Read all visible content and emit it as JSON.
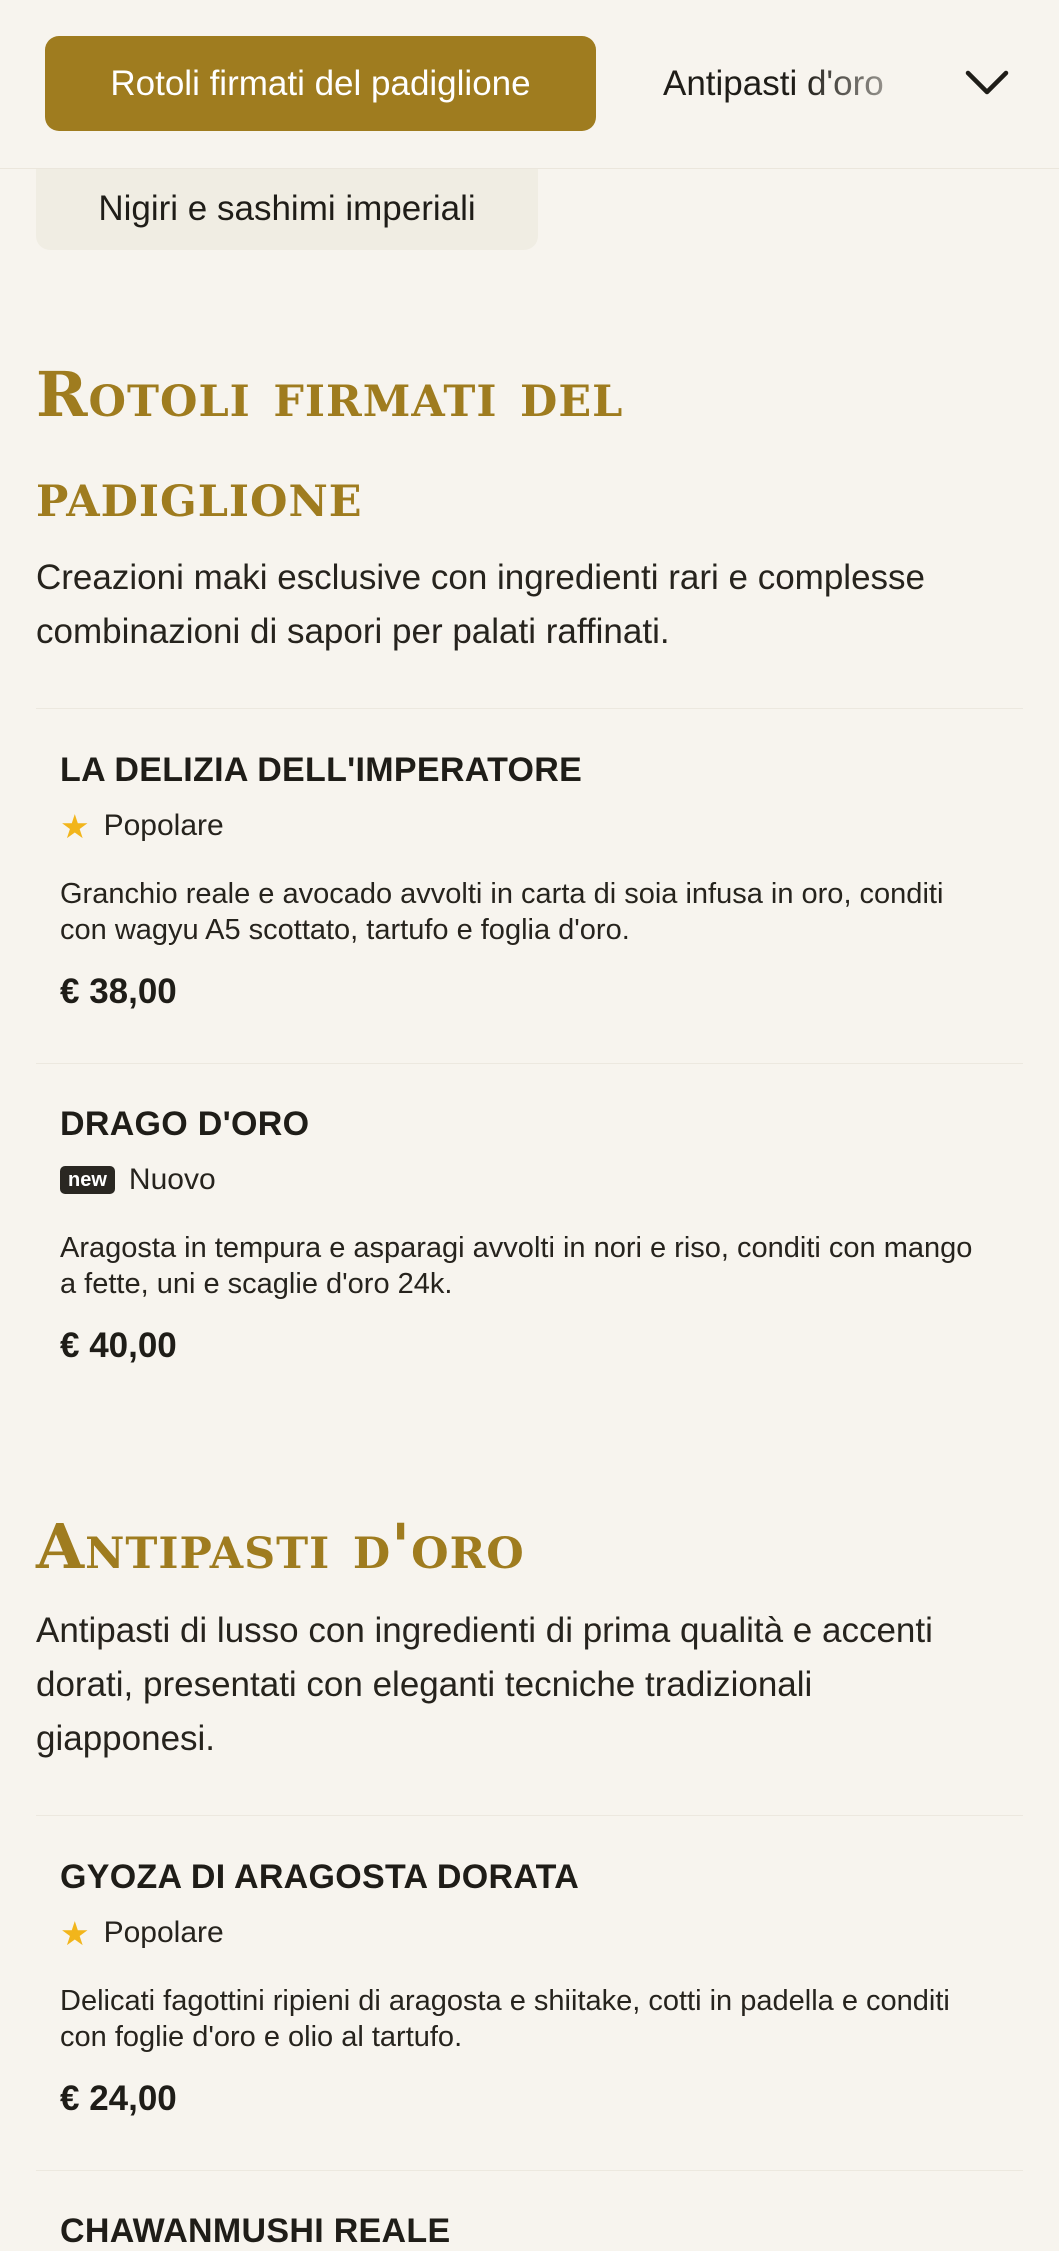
{
  "nav": {
    "active_category": "Rotoli firmati del padiglione",
    "next_category": "Antipasti d'oro",
    "second_row_category": "Nigiri e sashimi imperiali",
    "expand_icon": "chevron-down-icon"
  },
  "sections": [
    {
      "title": "Rotoli firmati del padiglione",
      "description": "Creazioni maki esclusive con ingredienti rari e complesse combinazioni di sapori per palati raffinati.",
      "items": [
        {
          "name": "LA DELIZIA DELL'IMPERATORE",
          "badge_type": "star-icon",
          "badge_label": "Popolare",
          "description": "Granchio reale e avocado avvolti in carta di soia infusa in oro, conditi con wagyu A5 scottato, tartufo e foglia d'oro.",
          "price": "€ 38,00"
        },
        {
          "name": "DRAGO D'ORO",
          "badge_type": "new-pill",
          "badge_pill": "new",
          "badge_label": "Nuovo",
          "description": "Aragosta in tempura e asparagi avvolti in nori e riso, conditi con mango a fette, uni e scaglie d'oro 24k.",
          "price": "€ 40,00"
        }
      ]
    },
    {
      "title": "Antipasti d'oro",
      "description": "Antipasti di lusso con ingredienti di prima qualità e accenti dorati, presentati con eleganti tecniche tradizionali giapponesi.",
      "items": [
        {
          "name": "GYOZA DI ARAGOSTA DORATA",
          "badge_type": "star-icon",
          "badge_label": "Popolare",
          "description": "Delicati fagottini ripieni di aragosta e shiitake, cotti in padella e conditi con foglie d'oro e olio al tartufo.",
          "price": "€ 24,00"
        },
        {
          "name": "CHAWANMUSHI REALE"
        }
      ]
    }
  ],
  "colors": {
    "accent_gold": "#9f7c1f",
    "background": "#f7f4ee",
    "star": "#f2b51b"
  }
}
